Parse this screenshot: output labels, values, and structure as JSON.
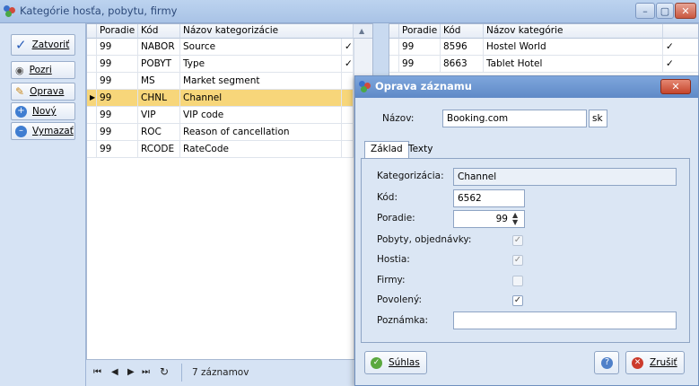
{
  "window": {
    "title": "Kategórie hosťa, pobytu, firmy",
    "minimize": "–",
    "maximize": "▢",
    "close": "✕"
  },
  "toolbar": {
    "close_label": "Zatvoriť",
    "view_label": "Pozri",
    "edit_label": "Oprava",
    "new_label": "Nový",
    "delete_label": "Vymazať"
  },
  "left_grid": {
    "columns": [
      "Poradie",
      "Kód",
      "Názov kategorizácie"
    ],
    "rows": [
      {
        "order": "99",
        "code": "NABOR",
        "name": "Source",
        "check": "✓",
        "selected": false
      },
      {
        "order": "99",
        "code": "POBYT",
        "name": "Type",
        "check": "✓",
        "selected": false
      },
      {
        "order": "99",
        "code": "MS",
        "name": "Market segment",
        "check": "",
        "selected": false
      },
      {
        "order": "99",
        "code": "CHNL",
        "name": "Channel",
        "check": "",
        "selected": true
      },
      {
        "order": "99",
        "code": "VIP",
        "name": "VIP code",
        "check": "",
        "selected": false
      },
      {
        "order": "99",
        "code": "ROC",
        "name": "Reason of cancellation",
        "check": "",
        "selected": false
      },
      {
        "order": "99",
        "code": "RCODE",
        "name": "RateCode",
        "check": "",
        "selected": false
      }
    ],
    "scroll_up": "▲"
  },
  "right_grid": {
    "columns": [
      "Poradie",
      "Kód",
      "Názov kategórie"
    ],
    "rows": [
      {
        "order": "99",
        "code": "8596",
        "name": "Hostel World",
        "check": "✓"
      },
      {
        "order": "99",
        "code": "8663",
        "name": "Tablet Hotel",
        "check": "✓"
      }
    ]
  },
  "footer": {
    "first": "⏮",
    "prev": "◀",
    "next": "▶",
    "last": "⏭",
    "refresh": "↻",
    "record_count": "7 záznamov"
  },
  "dialog": {
    "title": "Oprava záznamu",
    "close": "✕",
    "name_label": "Názov:",
    "name_value": "Booking.com",
    "lang": "sk",
    "tabs": [
      "Základ",
      "Texty"
    ],
    "fields": {
      "categorization_label": "Kategorizácia:",
      "categorization_value": "Channel",
      "code_label": "Kód:",
      "code_value": "6562",
      "order_label": "Poradie:",
      "order_value": "99",
      "stays_label": "Pobyty, objednávky:",
      "guests_label": "Hostia:",
      "firms_label": "Firmy:",
      "enabled_label": "Povolený:",
      "note_label": "Poznámka:",
      "note_value": ""
    },
    "checks": {
      "stays": "✓",
      "guests": "✓",
      "firms": "",
      "enabled": "✓"
    },
    "ok_label": "Súhlas",
    "cancel_label": "Zrušiť",
    "help": "?"
  },
  "colors": {
    "selected_row": "#f7d67a",
    "title_bar": "#bcd3ef",
    "dialog_title": "#6f97d2"
  }
}
